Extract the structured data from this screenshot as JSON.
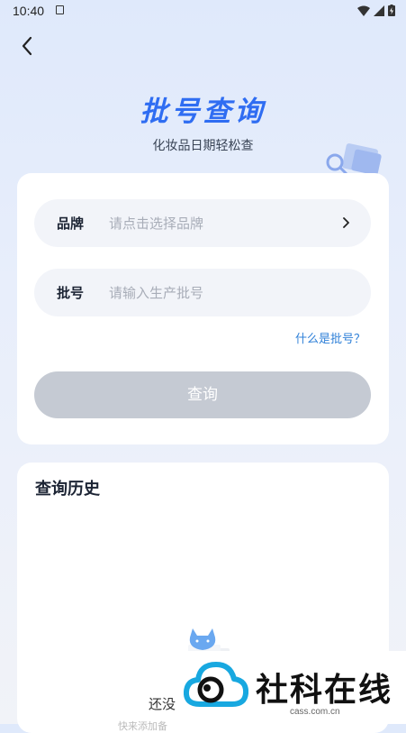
{
  "status_bar": {
    "time": "10:40"
  },
  "header": {
    "back_label": "back",
    "title": "批号查询",
    "subtitle": "化妆品日期轻松查"
  },
  "form": {
    "brand": {
      "label": "品牌",
      "placeholder": "请点击选择品牌"
    },
    "batch": {
      "label": "批号",
      "placeholder": "请输入生产批号",
      "value": ""
    },
    "help_link": "什么是批号？",
    "query_button": "查询"
  },
  "history": {
    "title": "查询历史",
    "empty_text": "还没",
    "empty_subtext": "快来添加备"
  },
  "watermark": {
    "brand_text": "社科在线",
    "url": "cass.com.cn"
  },
  "colors": {
    "accent": "#2f6df2",
    "link": "#2f80d8",
    "button_disabled": "#c5cad3",
    "watermark_cloud": "#18a8e0"
  }
}
